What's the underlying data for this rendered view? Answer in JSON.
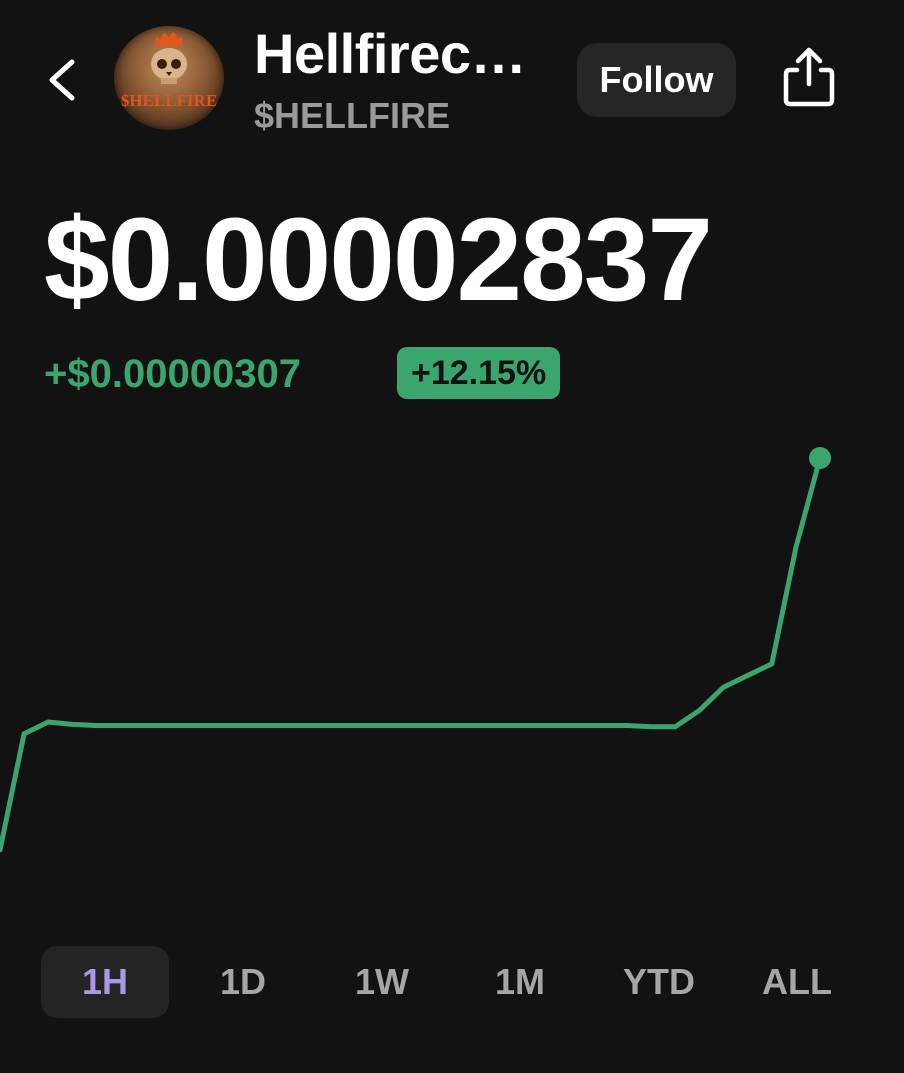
{
  "header": {
    "token_name": "Hellfirec…",
    "token_symbol": "$HELLFIRE",
    "follow_label": "Follow",
    "avatar_text": "$HELLFIRE"
  },
  "price": {
    "current": "$0.00002837",
    "change_abs": "+$0.00000307",
    "change_pct": "+12.15%"
  },
  "colors": {
    "background": "#121212",
    "positive": "#3aa66d",
    "active_tab_text": "#a999e6",
    "active_tab_bg": "#242424",
    "inactive_tab_text": "#a6a6a6"
  },
  "icons": {
    "back": "chevron-left-icon",
    "share": "share-icon"
  },
  "range_tabs": [
    "1H",
    "1D",
    "1W",
    "1M",
    "YTD",
    "ALL"
  ],
  "selected_range": "1H",
  "chart_data": {
    "type": "line",
    "series": [
      {
        "values": [
          2.5e-05,
          2.6e-05,
          2.61e-05,
          2.608e-05,
          2.607e-05,
          2.607e-05,
          2.607e-05,
          2.607e-05,
          2.607e-05,
          2.607e-05,
          2.607e-05,
          2.607e-05,
          2.607e-05,
          2.607e-05,
          2.607e-05,
          2.607e-05,
          2.607e-05,
          2.607e-05,
          2.607e-05,
          2.607e-05,
          2.607e-05,
          2.607e-05,
          2.607e-05,
          2.607e-05,
          2.607e-05,
          2.607e-05,
          2.607e-05,
          2.606e-05,
          2.606e-05,
          2.62e-05,
          2.64e-05,
          2.65e-05,
          2.66e-05,
          2.76e-05,
          2.837e-05
        ]
      }
    ],
    "end_marker": true
  }
}
